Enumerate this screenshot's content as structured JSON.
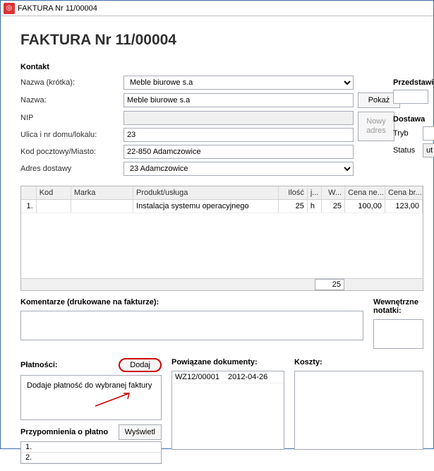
{
  "window": {
    "icon_glyph": "◎",
    "title": "FAKTURA Nr 11/00004"
  },
  "header": {
    "title": "FAKTURA Nr 11/00004"
  },
  "contact": {
    "section": "Kontakt",
    "labels": {
      "short_name": "Nazwa (krótka):",
      "name": "Nazwa:",
      "nip": "NIP",
      "street": "Ulica i nr domu/lokalu:",
      "post_city": "Kod pocztowy/Miasto:",
      "delivery": "Adres dostawy"
    },
    "values": {
      "short_name": "Meble biurowe s.a",
      "name": "Meble biurowe s.a",
      "nip": "",
      "street": "23",
      "post_city": "22-850 Adamczowice",
      "delivery": "23 Adamczowice"
    },
    "buttons": {
      "show": "Pokaż",
      "new_addr_l1": "Nowy",
      "new_addr_l2": "adres"
    }
  },
  "rep": {
    "section": "Przedstawic"
  },
  "delivery": {
    "section": "Dostawa",
    "mode_label": "Tryb",
    "status_label": "Status",
    "status_value": "ut"
  },
  "table": {
    "headers": {
      "kod": "Kod",
      "marka": "Marka",
      "produkt": "Produkt/usługa",
      "ilosc": "Ilość",
      "j": "j...",
      "w": "W...",
      "cena_ne": "Cena ne...",
      "cena_br": "Cena br..."
    },
    "rows": [
      {
        "n": "1.",
        "kod": "",
        "marka": "",
        "produkt": "Instalacja systemu operacyjnego",
        "ilosc": "25",
        "j": "h",
        "w": "25",
        "cena_ne": "100,00",
        "cena_br": "123,00"
      }
    ],
    "sum_ilosc": "25"
  },
  "comments": {
    "label": "Komentarze (drukowane na fakturze):",
    "value": ""
  },
  "internal_notes": {
    "label": "Wewnętrzne notatki:"
  },
  "payments": {
    "label": "Płatności:",
    "add_button": "Dodaj",
    "tooltip": "Dodaje płatność do wybranej faktury"
  },
  "reminders": {
    "label": "Przypomnienia o płatno",
    "show_button": "Wyświetl",
    "rows": [
      "1.",
      "2."
    ]
  },
  "linked_docs": {
    "label": "Powiązane dokumenty:",
    "rows": [
      {
        "num": "WZ12/00001",
        "date": "2012-04-26"
      }
    ]
  },
  "costs": {
    "label": "Koszty:"
  }
}
